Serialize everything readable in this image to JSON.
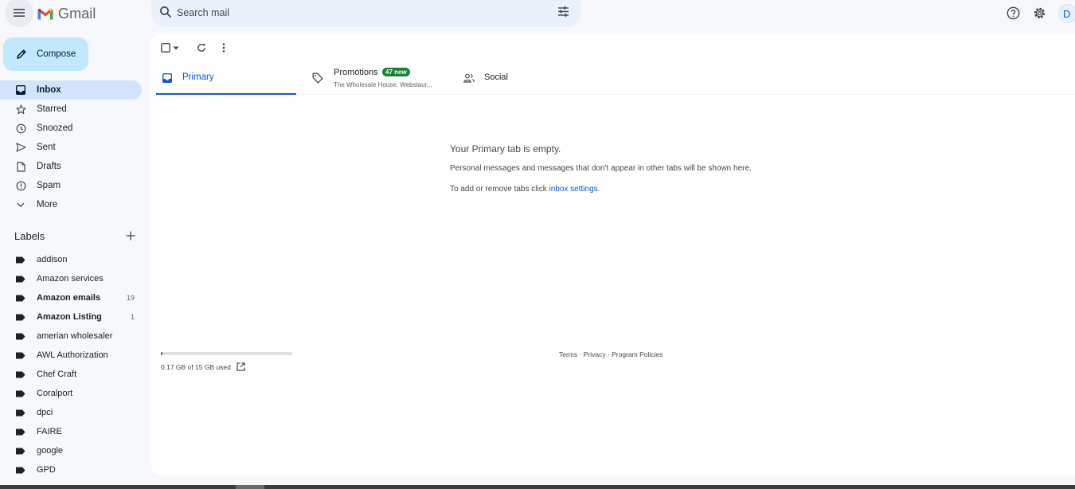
{
  "app": {
    "name": "Gmail"
  },
  "colors": {
    "accent": "#0b57d0",
    "compose_bg": "#c2e7ff",
    "active_nav": "#d3e3fd",
    "badge": "#188038"
  },
  "header": {
    "search_placeholder": "Search mail",
    "avatar_initial": "D"
  },
  "sidebar": {
    "compose_label": "Compose",
    "nav": [
      {
        "label": "Inbox",
        "icon": "inbox-icon",
        "active": true
      },
      {
        "label": "Starred",
        "icon": "star-icon"
      },
      {
        "label": "Snoozed",
        "icon": "clock-icon"
      },
      {
        "label": "Sent",
        "icon": "send-icon"
      },
      {
        "label": "Drafts",
        "icon": "draft-icon"
      },
      {
        "label": "Spam",
        "icon": "spam-icon"
      },
      {
        "label": "More",
        "icon": "chevron-down-icon"
      }
    ],
    "labels_title": "Labels",
    "labels": [
      {
        "name": "addison",
        "count": ""
      },
      {
        "name": "Amazon services",
        "count": ""
      },
      {
        "name": "Amazon emails",
        "count": "19",
        "bold": true
      },
      {
        "name": "Amazon Listing",
        "count": "1",
        "bold": true
      },
      {
        "name": "amerian wholesaler",
        "count": ""
      },
      {
        "name": "AWL Authorization",
        "count": ""
      },
      {
        "name": "Chef Craft",
        "count": ""
      },
      {
        "name": "Coralport",
        "count": ""
      },
      {
        "name": "dpci",
        "count": ""
      },
      {
        "name": "FAIRE",
        "count": ""
      },
      {
        "name": "google",
        "count": ""
      },
      {
        "name": "GPD",
        "count": ""
      }
    ]
  },
  "tabs": {
    "primary": {
      "label": "Primary"
    },
    "promotions": {
      "label": "Promotions",
      "badge": "47 new",
      "snippet": "The Wholesale House, Webstaur..."
    },
    "social": {
      "label": "Social"
    }
  },
  "empty_state": {
    "title": "Your Primary tab is empty.",
    "description": "Personal messages and messages that don't appear in other tabs will be shown here.",
    "hint_prefix": "To add or remove tabs click ",
    "hint_link": "inbox settings",
    "hint_suffix": "."
  },
  "storage": {
    "text": "0.17 GB of 15 GB used",
    "used_fraction": 0.011
  },
  "footer": {
    "terms": "Terms",
    "privacy": "Privacy",
    "policies": "Program Policies",
    "separator": " · "
  }
}
